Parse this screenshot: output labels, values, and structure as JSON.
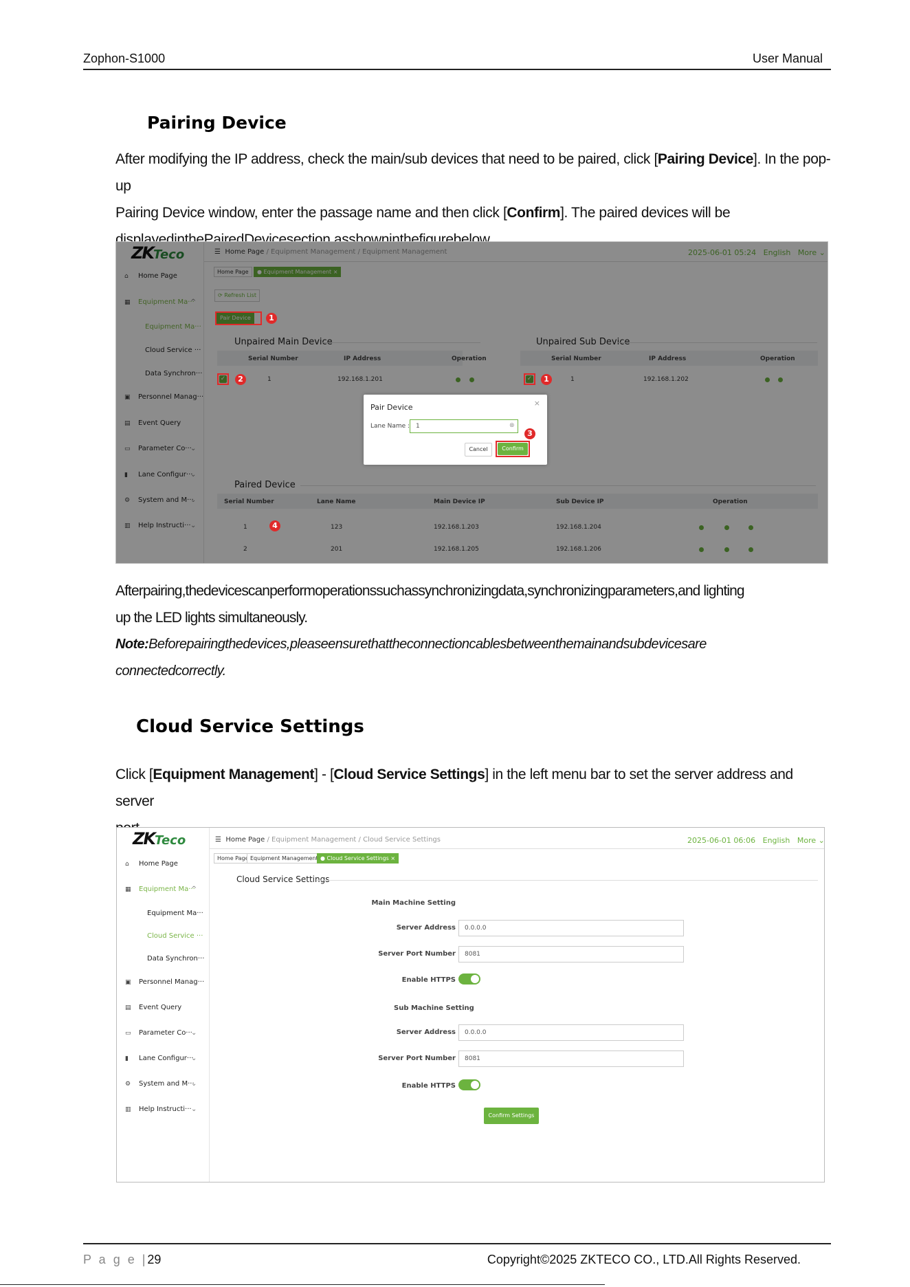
{
  "header": {
    "product": "Zophon-S1000",
    "doc": "User Manual"
  },
  "section1": {
    "title": "Pairing Device",
    "p1_a": "After modifying the IP address, check the main/sub devices that need to be paired, click [",
    "p1_b": "Pairing Device",
    "p1_c": "]. In the pop-up",
    "p2_a": "Pairing Device window, enter the passage name and then click [",
    "p2_b": "Confirm",
    "p2_c": "]. The paired devices will be",
    "p3": "displayedinthePairedDevicesection,asshowninthefigurebelow.",
    "after1": "Afterpairing,thedevicescanperformoperationssuchassynchronizingdata,synchronizingparameters,and lighting",
    "after2": "up the LED lights simultaneously.",
    "note_label": "Note:",
    "note1": "Beforepairingthedevices,pleaseensurethattheconnectioncablesbetweenthemainandsubdevicesare",
    "note2": "connectedcorrectly."
  },
  "section2": {
    "title": "Cloud Service Settings",
    "p1_a": "Click [",
    "p1_b": "Equipment Management",
    "p1_c": "] - [",
    "p1_d": "Cloud Service Settings",
    "p1_e": "] in the left menu bar to set the server address and server",
    "p2": "port."
  },
  "ui": {
    "logo": "ZK",
    "logo2": "Teco",
    "menu": [
      "Home Page",
      "Equipment Ma···",
      "Equipment Ma···",
      "Cloud Service ···",
      "Data Synchron···",
      "Personnel Manag···",
      "Event Query",
      "Parameter Co···",
      "Lane Configur···",
      "System and M···",
      "Help Instructi···"
    ],
    "crumb_home": "Home Page",
    "crumb_sep": "/",
    "crumb_em": "Equipment Management",
    "crumb_cloud": "Cloud Service Settings",
    "language": "English",
    "more": "More ⌄",
    "tab_home": "Home Page",
    "tab_em": "● Equipment Management ×",
    "tab_em2": "Equipment Management ×",
    "tab_cloud": "● Cloud Service Settings ×"
  },
  "shot1": {
    "datetime": "2025-06-01 05:24",
    "refresh": "⟳ Refresh List",
    "pair_btn": "Pair Device",
    "unpaired_main": "Unpaired Main Device",
    "unpaired_sub": "Unpaired Sub Device",
    "col_serial": "Serial Number",
    "col_ip": "IP Address",
    "col_op": "Operation",
    "main_row": {
      "serial": "1",
      "ip": "192.168.1.201"
    },
    "sub_row": {
      "serial": "1",
      "ip": "192.168.1.202"
    },
    "dialog_title": "Pair Device",
    "lane_label": "Lane Name :",
    "lane_value": "1",
    "cancel": "Cancel",
    "confirm": "Confirm",
    "paired": "Paired Device",
    "pcol": [
      "Serial Number",
      "Lane Name",
      "Main Device IP",
      "Sub Device IP",
      "Operation"
    ],
    "prows": [
      {
        "serial": "1",
        "lane": "123",
        "main": "192.168.1.203",
        "sub": "192.168.1.204"
      },
      {
        "serial": "2",
        "lane": "201",
        "main": "192.168.1.205",
        "sub": "192.168.1.206"
      }
    ],
    "badges": [
      "1",
      "2",
      "1",
      "3",
      "4"
    ]
  },
  "shot2": {
    "datetime": "2025-06-01 06:06",
    "title": "Cloud Service Settings",
    "main_setting": "Main Machine Setting",
    "sub_setting": "Sub Machine Setting",
    "server_address": "Server Address",
    "server_port": "Server Port Number",
    "https": "Enable HTTPS",
    "main_addr": "0.0.0.0",
    "main_port": "8081",
    "sub_addr": "0.0.0.0",
    "sub_port": "8081",
    "confirm": "Confirm Settings"
  },
  "footer": {
    "page_label": "P a g e  |",
    "page_num": "29",
    "copyright": "Copyright©2025 ZKTECO CO., LTD.All Rights Reserved."
  }
}
